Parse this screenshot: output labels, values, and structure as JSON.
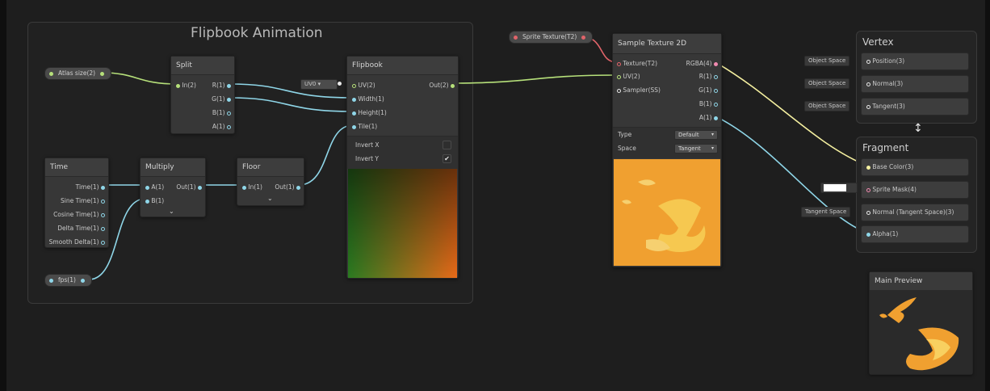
{
  "group": {
    "title": "Flipbook Animation"
  },
  "properties": {
    "atlas_size": "Atlas size(2)",
    "fps": "fps(1)",
    "sprite_texture": "Sprite Texture(T2)"
  },
  "split": {
    "title": "Split",
    "input": "In(2)",
    "outputs": [
      "R(1)",
      "G(1)",
      "B(1)",
      "A(1)"
    ]
  },
  "time": {
    "title": "Time",
    "outputs": [
      "Time(1)",
      "Sine Time(1)",
      "Cosine Time(1)",
      "Delta Time(1)",
      "Smooth Delta(1)"
    ]
  },
  "multiply": {
    "title": "Multiply",
    "inputs": [
      "A(1)",
      "B(1)"
    ],
    "output": "Out(1)"
  },
  "floor": {
    "title": "Floor",
    "input": "In(1)",
    "output": "Out(1)"
  },
  "flipbook": {
    "title": "Flipbook",
    "uv_dropdown": "UV0",
    "inputs": [
      "UV(2)",
      "Width(1)",
      "Height(1)",
      "Tile(1)"
    ],
    "output": "Out(2)",
    "invert_x_label": "Invert X",
    "invert_y_label": "Invert Y",
    "invert_x": false,
    "invert_y": true
  },
  "sample_texture": {
    "title": "Sample Texture 2D",
    "inputs": [
      "Texture(T2)",
      "UV(2)",
      "Sampler(SS)"
    ],
    "outputs": [
      "RGBA(4)",
      "R(1)",
      "G(1)",
      "B(1)",
      "A(1)"
    ],
    "type_label": "Type",
    "type_value": "Default",
    "space_label": "Space",
    "space_value": "Tangent"
  },
  "vertex": {
    "title": "Vertex",
    "slots": [
      {
        "inline": "Object Space",
        "label": "Position(3)"
      },
      {
        "inline": "Object Space",
        "label": "Normal(3)"
      },
      {
        "inline": "Object Space",
        "label": "Tangent(3)"
      }
    ]
  },
  "fragment": {
    "title": "Fragment",
    "slots": [
      {
        "inline": "",
        "label": "Base Color(3)"
      },
      {
        "inline": "",
        "label": "Sprite Mask(4)"
      },
      {
        "inline": "Tangent Space",
        "label": "Normal (Tangent Space)(3)"
      },
      {
        "inline": "",
        "label": "Alpha(1)"
      }
    ]
  },
  "main_preview": {
    "title": "Main Preview"
  },
  "colors": {
    "vector1": "#8fd6e8",
    "vector2": "#b6e07a",
    "vector3": "#f5f0a0",
    "vector4": "#f08ab0",
    "texture": "#e0646a",
    "preview_orange": "#f0a030"
  },
  "icons": [
    "chevron-down-icon",
    "checkmark-icon",
    "port-dot-icon",
    "resize-cursor-icon"
  ]
}
